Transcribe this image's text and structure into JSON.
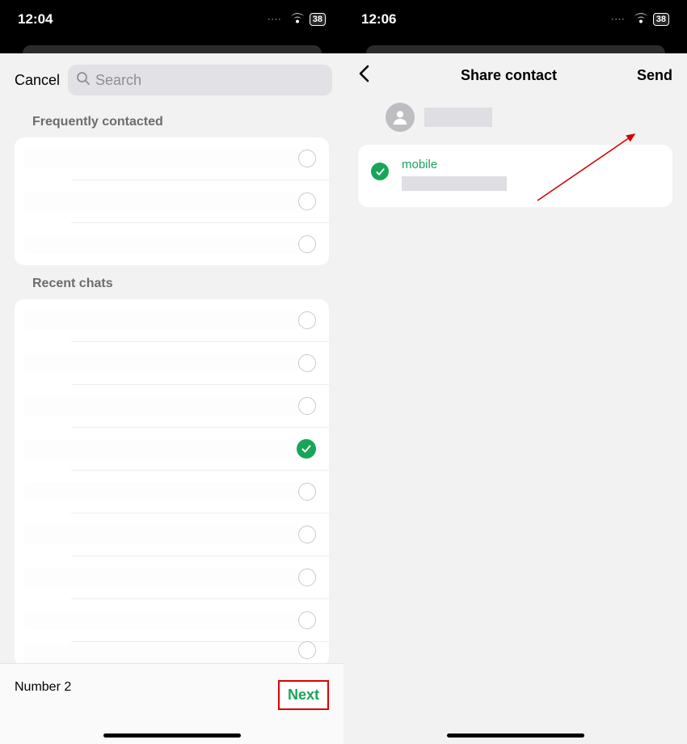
{
  "left": {
    "status": {
      "time": "12:04",
      "battery": "38",
      "dots": "····"
    },
    "cancel": "Cancel",
    "search_placeholder": "Search",
    "section_frequent": "Frequently contacted",
    "frequent_items": [
      {
        "checked": false
      },
      {
        "checked": false
      },
      {
        "checked": false
      }
    ],
    "section_recent": "Recent chats",
    "recent_items": [
      {
        "checked": false
      },
      {
        "checked": false
      },
      {
        "checked": false
      },
      {
        "checked": true
      },
      {
        "checked": false
      },
      {
        "checked": false
      },
      {
        "checked": false
      },
      {
        "checked": false
      },
      {
        "checked": false
      }
    ],
    "selected_label": "Number 2",
    "next": "Next"
  },
  "right": {
    "status": {
      "time": "12:06",
      "battery": "38",
      "dots": "····"
    },
    "title": "Share contact",
    "send": "Send",
    "field_label": "mobile",
    "field_checked": true
  }
}
